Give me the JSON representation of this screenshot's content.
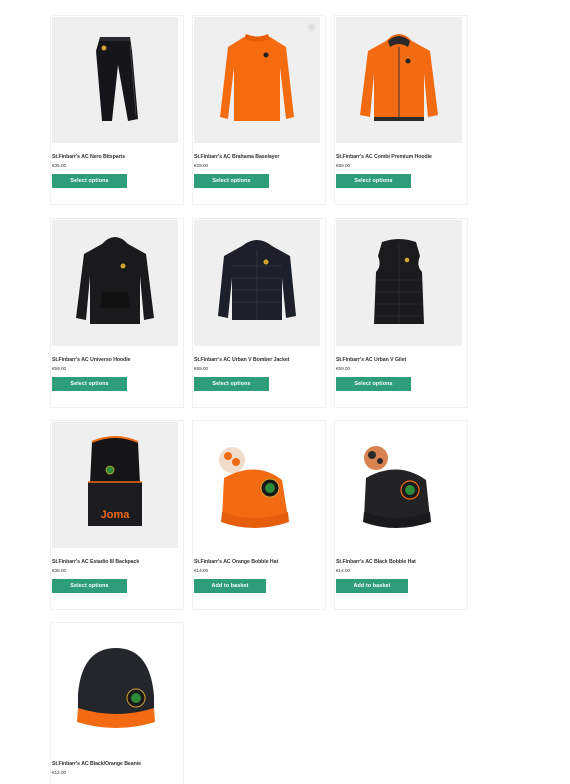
{
  "products": [
    {
      "title": "St.Finbarr's AC Nero Bitsparts",
      "price": "€35.00",
      "button": "Select options",
      "image": "black-tracksuit-pants"
    },
    {
      "title": "St.Finbarr's AC Brahama Baselayer",
      "price": "€29.00",
      "button": "Select options",
      "image": "orange-baselayer"
    },
    {
      "title": "St.Finbarr's AC Combi Premium Hoodie",
      "price": "€59.00",
      "button": "Select options",
      "image": "orange-hoodie"
    },
    {
      "title": "St.Finbarr's AC Universo Hoodie",
      "price": "€59.00",
      "button": "Select options",
      "image": "black-hoodie"
    },
    {
      "title": "St.Finbarr's AC Urban V Bomber Jacket",
      "price": "€69.00",
      "button": "Select options",
      "image": "black-bomber-jacket"
    },
    {
      "title": "St.Finbarr's AC Urban V Gilet",
      "price": "€59.00",
      "button": "Select options",
      "image": "black-gilet"
    },
    {
      "title": "St.Finbarr's AC Estadio III Backpack",
      "price": "€38.00",
      "button": "Select options",
      "image": "black-orange-backpack"
    },
    {
      "title": "St.Finbarr's AC Orange Bobble Hat",
      "price": "€14.00",
      "button": "Add to basket",
      "image": "orange-bobble-hat"
    },
    {
      "title": "St.Finbarr's AC Black Bobble Hat",
      "price": "€14.00",
      "button": "Add to basket",
      "image": "black-bobble-hat"
    },
    {
      "title": "St.Finbarr's AC Black/Orange Beanie",
      "price": "€12.00",
      "button": "",
      "image": "black-orange-beanie"
    }
  ],
  "colors": {
    "button": "#2e9d7a",
    "orange": "#f26b12",
    "black": "#1c1c1e"
  },
  "wishlist_icon": "heart-icon"
}
